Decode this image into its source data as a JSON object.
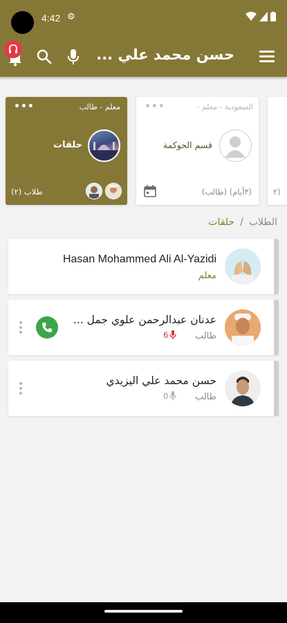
{
  "status_bar": {
    "time": "4:42"
  },
  "app_bar": {
    "title": "حسن محمد علي ..."
  },
  "cards": [
    {
      "subtitle": "معلم - طالب",
      "name": "حلقات",
      "footer": "طلاب (٢)"
    },
    {
      "subtitle": "السعودية - معلم -",
      "name": "قسم الحوكمة",
      "footer": "(٣أيام) (طالب)"
    },
    {
      "footer": "(٢"
    }
  ],
  "breadcrumb": {
    "root": "الطلاب",
    "separator": "/",
    "current": "حلقات"
  },
  "members": [
    {
      "name": "Hasan Mohammed Ali Al-Yazidi",
      "role": "معلم"
    },
    {
      "name": "عدنان عبدالرحمن علوي جمل ...",
      "role": "طالب",
      "mic_count": "6"
    },
    {
      "name": "حسن محمد علي اليزيدي",
      "role": "طالب",
      "mic_count": "0"
    }
  ],
  "colors": {
    "primary": "#857837",
    "accent": "#e23a46",
    "call": "#3aa54a",
    "mic_active": "#d9363e",
    "role": "#8a7b2e"
  },
  "icons": [
    "menu-icon",
    "mic-icon",
    "search-icon",
    "bell-icon",
    "calendar-icon",
    "phone-icon",
    "more-icon"
  ]
}
